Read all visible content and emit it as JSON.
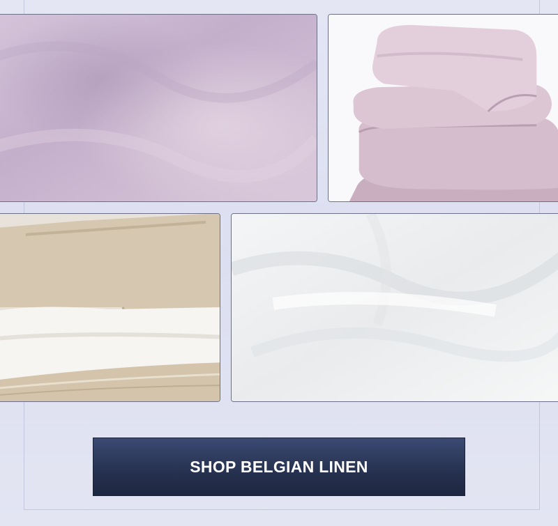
{
  "gallery": {
    "tiles": [
      {
        "name": "lilac-linen-fabric-texture",
        "color": "#cdb9d2"
      },
      {
        "name": "lilac-folded-duvet-stack",
        "color": "#d3bccc"
      },
      {
        "name": "natural-white-linen-stack",
        "color": "#d9cbb6"
      },
      {
        "name": "white-linen-fabric-texture",
        "color": "#eef0f1"
      }
    ]
  },
  "cta": {
    "label": "SHOP BELGIAN LINEN",
    "color": "#26314f"
  }
}
